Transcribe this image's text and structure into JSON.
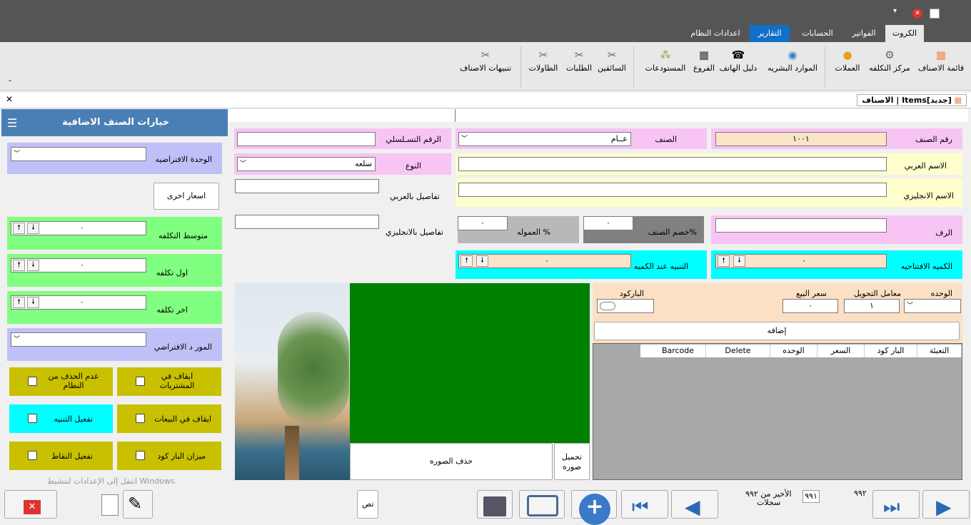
{
  "ribbon_tabs": [
    "الكروت",
    "الفواتير",
    "الحسابات",
    "التقارير",
    "اعدادات النظام"
  ],
  "ribbon_items": [
    "قائمة الاصناف",
    "مركز التكلفه",
    "العملات",
    "الموارد البشريه",
    "دليل الهاتف",
    "الفروع",
    "المستودعات",
    "السائقين",
    "الطلبات",
    "الطاولات",
    "تنبيهات الاصناف"
  ],
  "doc_title": "الاصناف | Items[جديد]",
  "sidebar": {
    "title": "خيارات الصنف الاضافية",
    "default_unit": "الوحدة الافتراضيه",
    "other_prices": "اسعار اخرى",
    "avg_cost": "متوسط التكلفه",
    "first_cost": "اول تكلفه",
    "last_cost": "اخر تكلفه",
    "default_supplier": "المور د الافتراضي",
    "stop_purchases": "ايقاف في المشتريات",
    "no_delete": "عدم الحذف من النظام",
    "stop_sales": "ايقاف في البيعات",
    "enable_alert": "تفعيل التنبيه",
    "scale_barcode": "ميزان البار كود",
    "enable_points": "تفعيل النقاط",
    "zero": "٠"
  },
  "form": {
    "item_no_label": "رقم الصنف",
    "item_no": "١٠٠١",
    "class_label": "الصنف",
    "class_value": "عــام",
    "serial_label": "الرقم التسـلسلي",
    "arabic_name_label": "الاسم العربي",
    "type_label": "النوع",
    "type_value": "سلعه",
    "english_name_label": "الاسم الانجليزي",
    "details_ar_label": "تفاصيل بالعربي",
    "shelf_label": "الرف",
    "discount_label": "خصم الصنف%",
    "discount_value": "٠",
    "commission_label": "العموله %",
    "commission_value": "٠",
    "details_en_label": "تفاصيل بالانجليزي",
    "opening_qty_label": "الكميه الافتتاحيه",
    "opening_qty": "٠",
    "alert_qty_label": "التنبيه عند الكميه",
    "alert_qty": "٠"
  },
  "units": {
    "unit_label": "الوحده",
    "factor_label": "معامل التحويل",
    "factor_value": "١",
    "price_label": "سعر البيع",
    "price_value": "٠",
    "barcode_label": "الباركود",
    "add_button": "إضافه",
    "columns": [
      "التعبئة",
      "البار كود",
      "السعر",
      "الوحده",
      "Delete",
      "Barcode"
    ]
  },
  "image": {
    "load_button": "تحميل صوره",
    "delete_button": "حذف الصوره"
  },
  "nav": {
    "last_of": "الأخير من ٩٩٢",
    "records": "سجلات",
    "current": "٩٩١",
    "total": "٩٩٢",
    "misc": "تص"
  },
  "watermark": "انتقل إلى الإعدادات لتنشيط Windows."
}
